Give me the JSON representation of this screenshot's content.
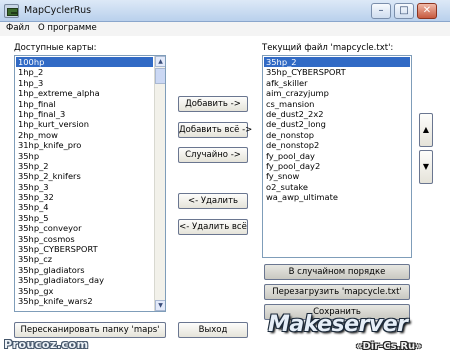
{
  "window": {
    "title": "MapCyclerRus",
    "minimize": "–",
    "maximize": "□",
    "close": "✕"
  },
  "menu": [
    "Файл",
    "О программе"
  ],
  "left_panel": {
    "label": "Доступные карты:",
    "selected_index": 0,
    "items": [
      "100hp",
      "1hp_2",
      "1hp_3",
      "1hp_extreme_alpha",
      "1hp_final",
      "1hp_final_3",
      "1hp_kurt_version",
      "2hp_mow",
      "31hp_knife_pro",
      "35hp",
      "35hp_2",
      "35hp_2_knifers",
      "35hp_3",
      "35hp_32",
      "35hp_4",
      "35hp_5",
      "35hp_conveyor",
      "35hp_cosmos",
      "35hp_CYBERSPORT",
      "35hp_cz",
      "35hp_gladiators",
      "35hp_gladiators_day",
      "35hp_gx",
      "35hp_knife_wars2"
    ]
  },
  "middle_buttons": {
    "add": "Добавить ->",
    "add_all": "Добавить всё ->",
    "random": "Случайно ->",
    "remove": "<- Удалить",
    "remove_all": "<- Удалить всё"
  },
  "right_panel": {
    "label": "Текущий файл 'mapcycle.txt':",
    "selected_index": 0,
    "items": [
      "35hp_2",
      "35hp_CYBERSPORT",
      "afk_skiller",
      "aim_crazyjump",
      "cs_mansion",
      "de_dust2_2x2",
      "de_dust2_long",
      "de_nonstop",
      "de_nonstop2",
      "fy_pool_day",
      "fy_pool_day2",
      "fy_snow",
      "o2_sutake",
      "wa_awp_ultimate"
    ]
  },
  "order_buttons": {
    "up_icon": "▲",
    "down_icon": "▼"
  },
  "right_buttons": {
    "shuffle": "В случайном порядке",
    "reload": "Перезагрузить 'mapcycle.txt'",
    "save": "Сохранить"
  },
  "bottom_buttons": {
    "rescan": "Пересканировать папку 'maps'",
    "exit": "Выход"
  },
  "watermarks": {
    "left": "Proucoz.com",
    "logo": "Makeserver",
    "right": "«Dir-Cs.Ru»"
  }
}
